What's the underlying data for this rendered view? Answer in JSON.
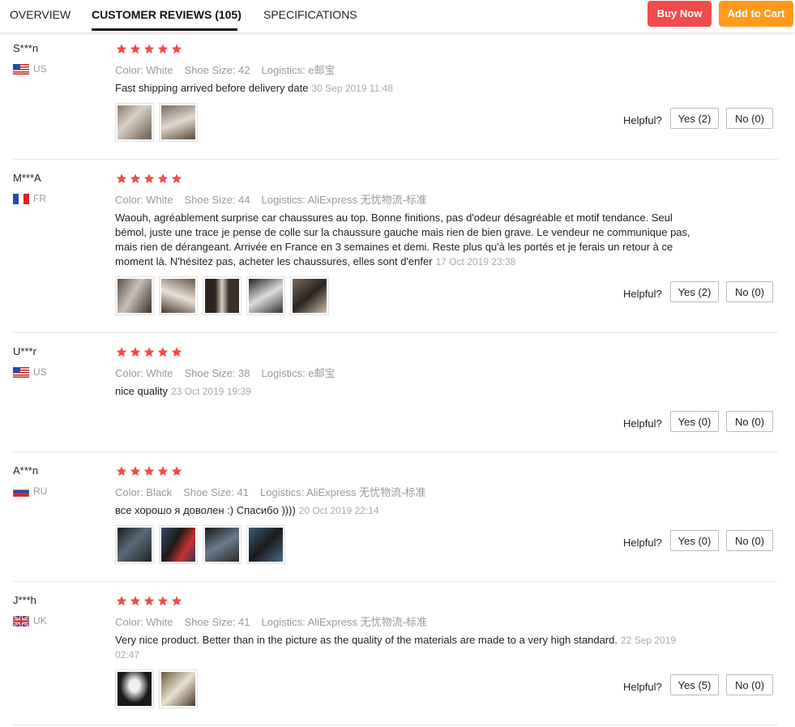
{
  "tabs": {
    "overview": "OVERVIEW",
    "reviews": "CUSTOMER REVIEWS (105)",
    "specifications": "SPECIFICATIONS"
  },
  "actions": {
    "buy_now": "Buy Now",
    "add_to_cart": "Add to Cart"
  },
  "colors": {
    "buy": "#f04c4c",
    "cart": "#ff9a1a",
    "star": "#f04c4c"
  },
  "reviews": [
    {
      "user": "S***n",
      "country": "US",
      "flag": "us-flag-icon",
      "rating": 5,
      "color": "Color: White",
      "size": "Shoe Size: 42",
      "logistics": "Logistics: e邮宝",
      "text": "Fast shipping arrived before delivery date",
      "date": "30 Sep 2019 11:48",
      "helpful": "Helpful?",
      "yes": "Yes (2)",
      "no": "No (0)",
      "photos": 2
    },
    {
      "user": "M***A",
      "country": "FR",
      "flag": "fr-flag-icon",
      "rating": 5,
      "color": "Color: White",
      "size": "Shoe Size: 44",
      "logistics": "Logistics: AliExpress 无忧物流-标准",
      "text": "Waouh, agréablement surprise car chaussures au top. Bonne finitions, pas d'odeur désagréable et motif tendance. Seul bémol, juste une trace je pense de colle sur la chaussure gauche mais rien de bien grave. Le vendeur ne communique pas, mais rien de dérangeant. Arrivée en France en 3 semaines et demi. Reste plus qu'à les portés et je ferais un retour à ce moment là. N'hésitez pas, acheter les chaussures, elles sont d'enfer",
      "date": "17 Oct 2019 23:38",
      "helpful": "Helpful?",
      "yes": "Yes (2)",
      "no": "No (0)",
      "photos": 5
    },
    {
      "user": "U***r",
      "country": "US",
      "flag": "us-flag-icon",
      "rating": 5,
      "color": "Color: White",
      "size": "Shoe Size: 38",
      "logistics": "Logistics: e邮宝",
      "text": "nice quality",
      "date": "23 Oct 2019 19:39",
      "helpful": "Helpful?",
      "yes": "Yes (0)",
      "no": "No (0)",
      "photos": 0
    },
    {
      "user": "A***n",
      "country": "RU",
      "flag": "ru-flag-icon",
      "rating": 5,
      "color": "Color: Black",
      "size": "Shoe Size: 41",
      "logistics": "Logistics: AliExpress 无忧物流-标准",
      "text": "все хорошо я доволен :) Спасибо ))))",
      "date": "20 Oct 2019 22:14",
      "helpful": "Helpful?",
      "yes": "Yes (0)",
      "no": "No (0)",
      "photos": 4
    },
    {
      "user": "J***h",
      "country": "UK",
      "flag": "uk-flag-icon",
      "rating": 5,
      "color": "Color: White",
      "size": "Shoe Size: 41",
      "logistics": "Logistics: AliExpress 无忧物流-标准",
      "text": "Very nice product. Better than in the picture as the quality of the materials are made to a very high standard.",
      "date": "22 Sep 2019 02:47",
      "helpful": "Helpful?",
      "yes": "Yes (5)",
      "no": "No (0)",
      "photos": 2
    }
  ]
}
